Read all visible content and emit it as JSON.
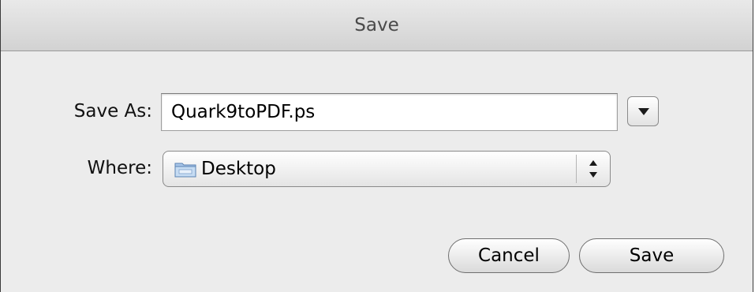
{
  "dialog": {
    "title": "Save"
  },
  "save_as": {
    "label": "Save As:",
    "value": "Quark9toPDF.ps"
  },
  "where": {
    "label": "Where:",
    "selected": "Desktop",
    "icon": "folder-icon"
  },
  "buttons": {
    "cancel_label": "Cancel",
    "save_label": "Save"
  }
}
